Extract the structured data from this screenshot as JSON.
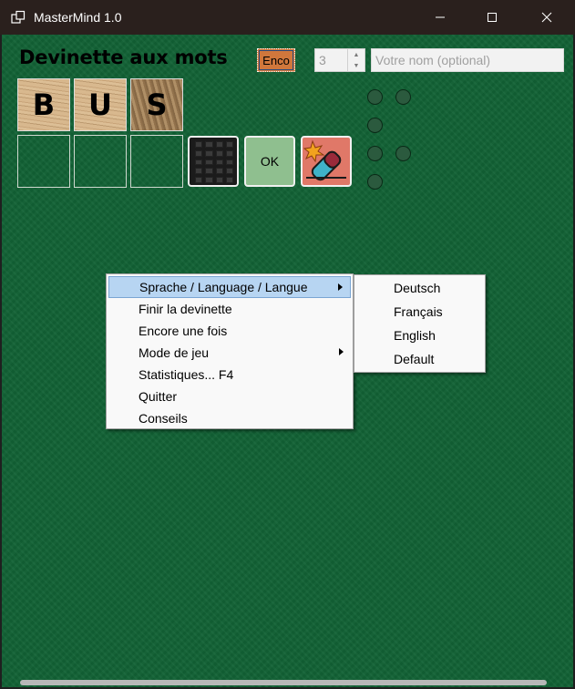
{
  "window": {
    "title": "MasterMind 1.0",
    "icon": "window-switcher-icon",
    "controls": [
      "minimize-icon",
      "maximize-icon",
      "close-icon"
    ]
  },
  "game": {
    "heading": "Devinette aux mots",
    "button_label": "Enco",
    "button_color": "#d0773c",
    "word_length": "3",
    "name_placeholder": "Votre nom (optional)",
    "guess_letters": [
      "B",
      "U",
      "S"
    ],
    "ok_label": "OK",
    "ok_color": "#8fbf8f",
    "eraser_color": "#e07868",
    "board_color": "#126235"
  },
  "context_menu": {
    "items": [
      {
        "label": "Sprache / Language / Langue",
        "submenu": true,
        "highlighted": true
      },
      {
        "label": "Finir la devinette",
        "submenu": false
      },
      {
        "label": "Encore une fois",
        "submenu": false
      },
      {
        "label": "Mode de jeu",
        "submenu": true
      },
      {
        "label": "Statistiques... F4",
        "submenu": false
      },
      {
        "label": "Quitter",
        "submenu": false
      },
      {
        "label": "Conseils",
        "submenu": false
      }
    ],
    "highlight_color": "#b7d5f2"
  },
  "language_submenu": {
    "items": [
      "Deutsch",
      "Français",
      "English",
      "Default"
    ]
  }
}
